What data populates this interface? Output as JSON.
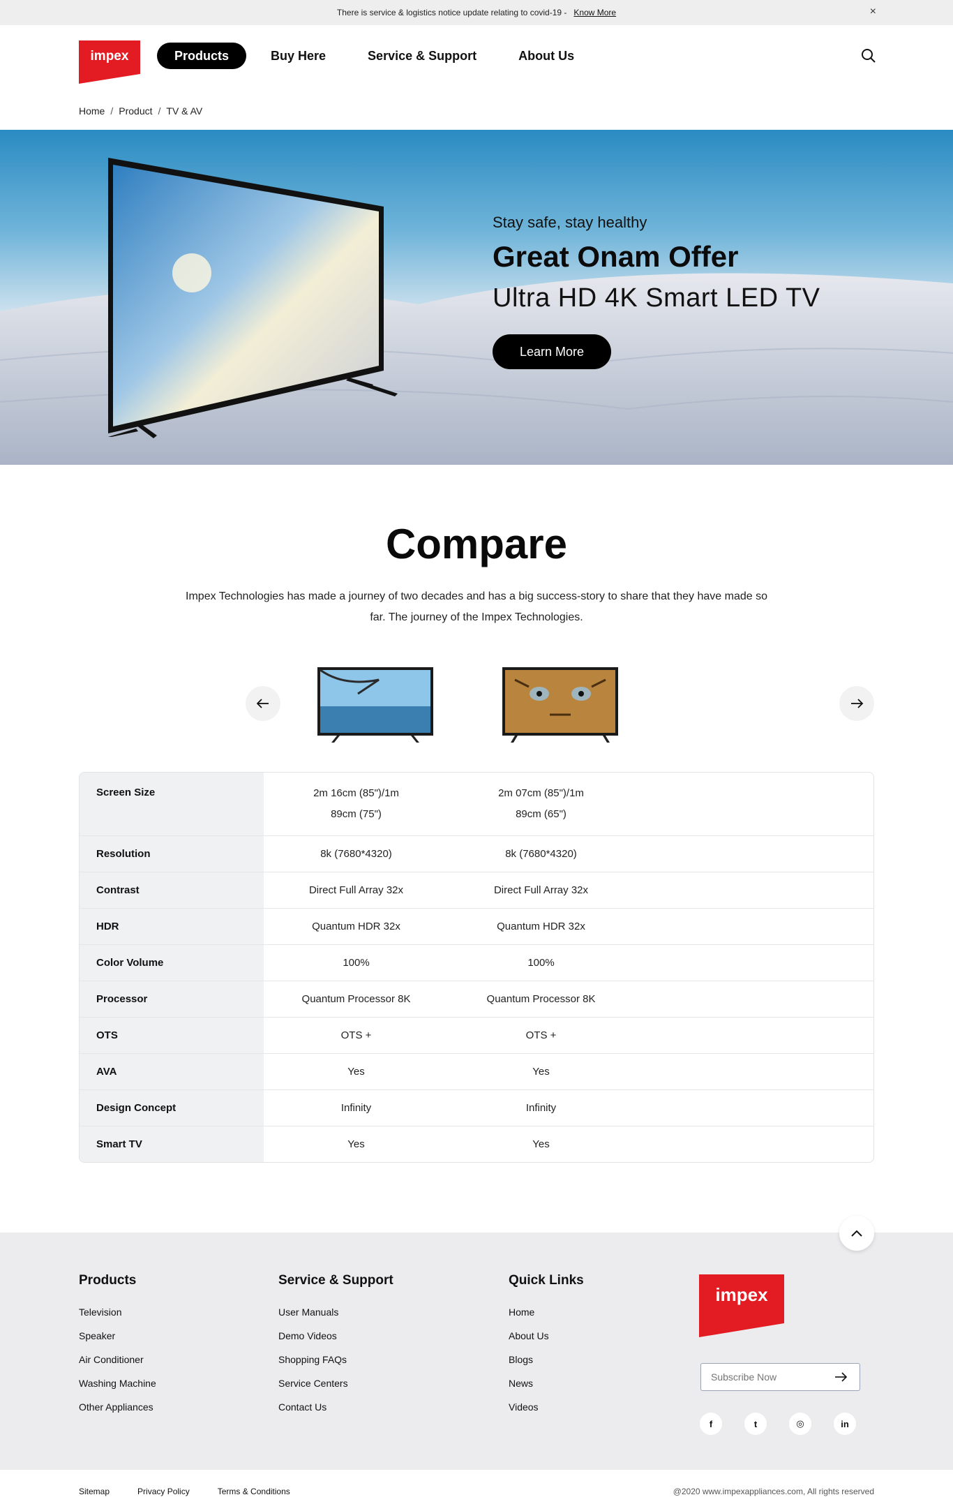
{
  "notice": {
    "text": "There is service & logistics notice update relating to covid-19  -",
    "link": "Know More",
    "close": "×"
  },
  "brand": {
    "logo_text": "impex",
    "color": "#e31b23"
  },
  "nav": {
    "items": [
      {
        "label": "Products"
      },
      {
        "label": "Buy Here"
      },
      {
        "label": "Service & Support"
      },
      {
        "label": "About Us"
      }
    ]
  },
  "breadcrumb": {
    "items": [
      "Home",
      "Product",
      "TV & AV"
    ],
    "separator": "/"
  },
  "hero": {
    "subtitle": "Stay safe, stay healthy",
    "title": "Great Onam Offer",
    "model": "Ultra HD 4K Smart LED TV",
    "button": "Learn More"
  },
  "compare": {
    "title": "Compare",
    "description": "Impex Technologies has made a journey of two decades and has a big success-story to share that they have made so far. The journey of the Impex Technologies.",
    "rows": [
      {
        "label": "Screen Size",
        "values": [
          "2m 16cm (85\")/1m 89cm (75\")",
          "2m 07cm (85\")/1m 89cm (65\")"
        ]
      },
      {
        "label": "Resolution",
        "values": [
          "8k (7680*4320)",
          "8k (7680*4320)"
        ]
      },
      {
        "label": "Contrast",
        "values": [
          "Direct Full Array 32x",
          "Direct Full Array 32x"
        ]
      },
      {
        "label": "HDR",
        "values": [
          "Quantum HDR 32x",
          "Quantum HDR 32x"
        ]
      },
      {
        "label": "Color Volume",
        "values": [
          "100%",
          "100%"
        ]
      },
      {
        "label": "Processor",
        "values": [
          "Quantum Processor 8K",
          "Quantum Processor 8K"
        ]
      },
      {
        "label": "OTS",
        "values": [
          "OTS +",
          "OTS +"
        ]
      },
      {
        "label": "AVA",
        "values": [
          "Yes",
          "Yes"
        ]
      },
      {
        "label": "Design Concept",
        "values": [
          "Infinity",
          "Infinity"
        ]
      },
      {
        "label": "Smart TV",
        "values": [
          "Yes",
          "Yes"
        ]
      }
    ]
  },
  "footer": {
    "columns": [
      {
        "title": "Products",
        "links": [
          "Television",
          "Speaker",
          "Air Conditioner",
          "Washing Machine",
          "Other Appliances"
        ]
      },
      {
        "title": "Service & Support",
        "links": [
          "User Manuals",
          "Demo Videos",
          "Shopping FAQs",
          "Service Centers",
          "Contact Us"
        ]
      },
      {
        "title": "Quick Links",
        "links": [
          "Home",
          "About Us",
          "Blogs",
          "News",
          "Videos"
        ]
      }
    ],
    "subscribe_placeholder": "Subscribe Now",
    "socials": [
      {
        "icon": "facebook-icon",
        "glyph": "f"
      },
      {
        "icon": "twitter-icon",
        "glyph": "t"
      },
      {
        "icon": "instagram-icon",
        "glyph": "◎"
      },
      {
        "icon": "linkedin-icon",
        "glyph": "in"
      }
    ]
  },
  "bottom": {
    "links": [
      "Sitemap",
      "Privacy Policy",
      "Terms & Conditions"
    ],
    "copyright": "@2020 www.impexappliances.com, All rights reserved"
  }
}
